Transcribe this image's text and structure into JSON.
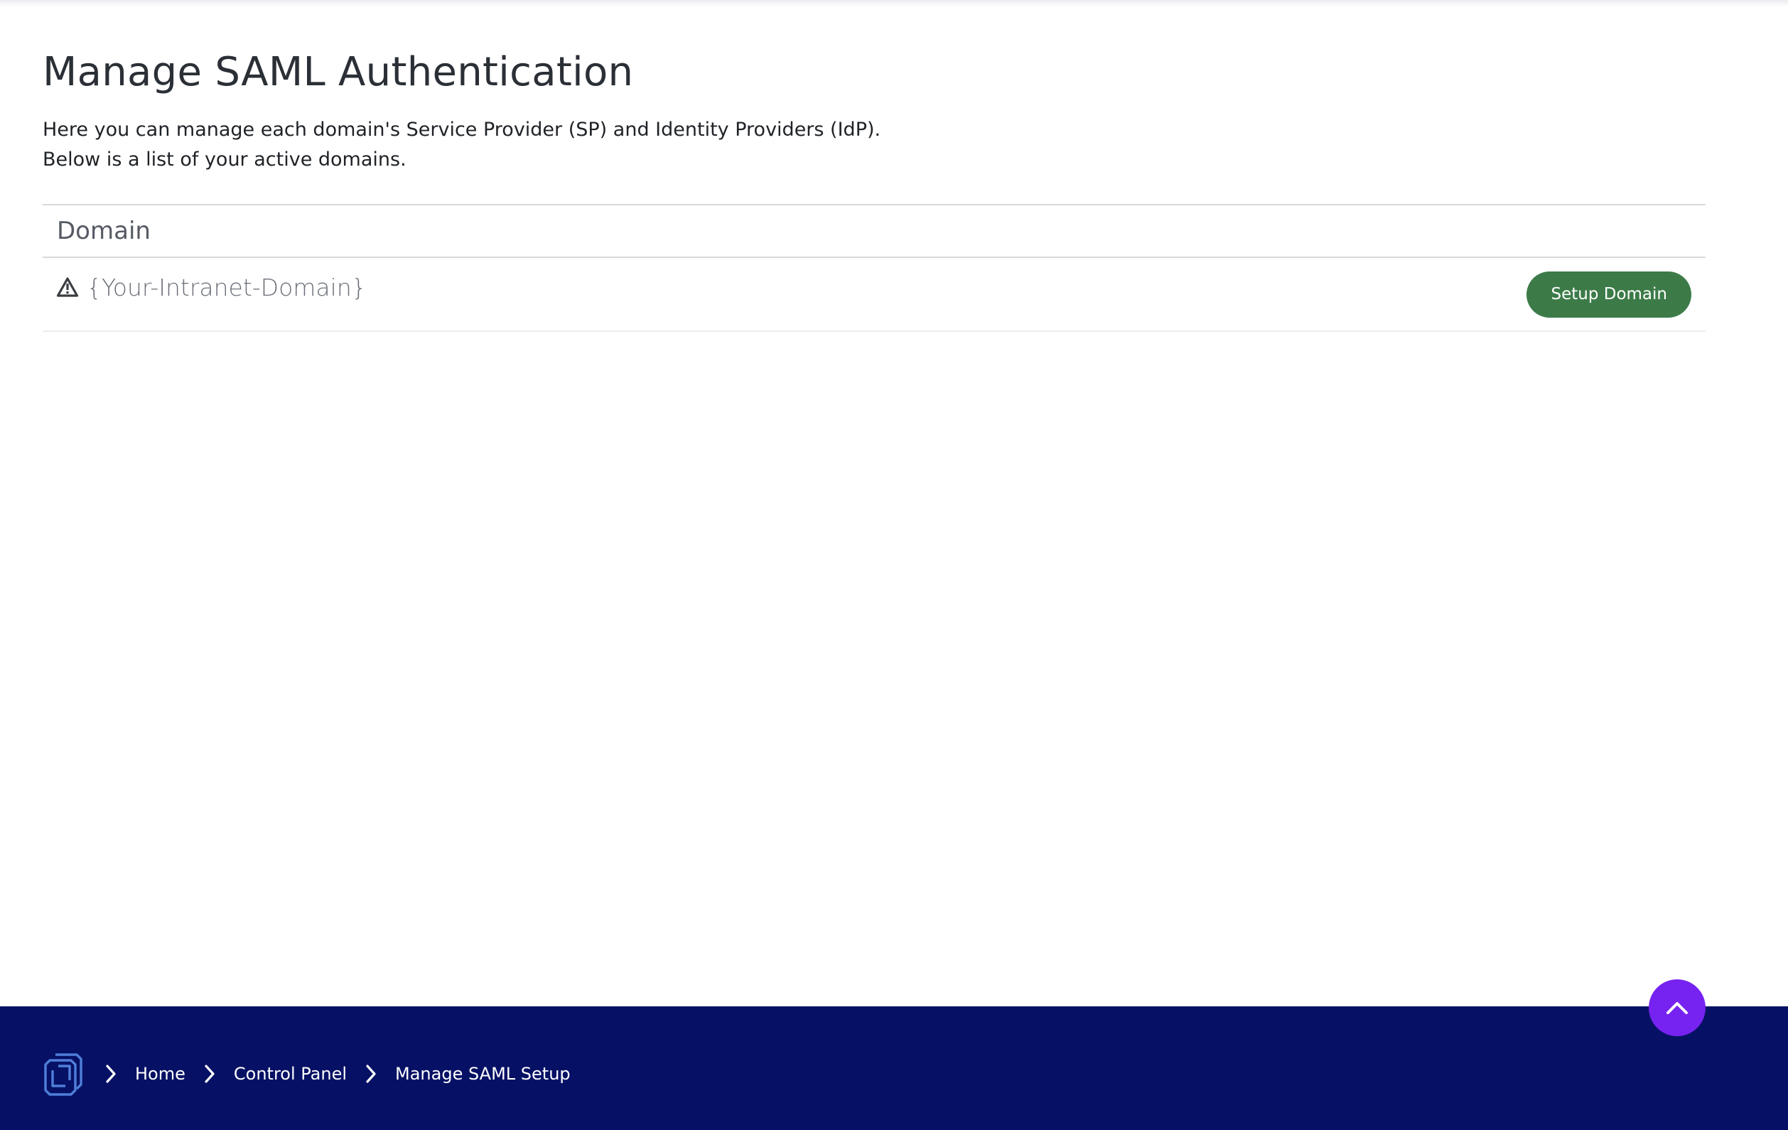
{
  "page": {
    "title": "Manage SAML Authentication",
    "intro_line_1": "Here you can manage each domain's Service Provider (SP) and Identity Providers (IdP).",
    "intro_line_2": "Below is a list of your active domains."
  },
  "table": {
    "column_header": "Domain",
    "rows": [
      {
        "status_icon": "warning-icon",
        "domain": "{Your-Intranet-Domain}",
        "action_label": "Setup Domain"
      }
    ]
  },
  "scroll_top": {
    "icon": "chevron-up-icon"
  },
  "footer": {
    "logo_icon": "layered-logo-icon",
    "breadcrumb": [
      "Home",
      "Control Panel",
      "Manage SAML Setup"
    ]
  },
  "colors": {
    "primary_button": "#3c7b48",
    "scroll_top_button": "#7622f0",
    "footer_background": "#061165"
  }
}
